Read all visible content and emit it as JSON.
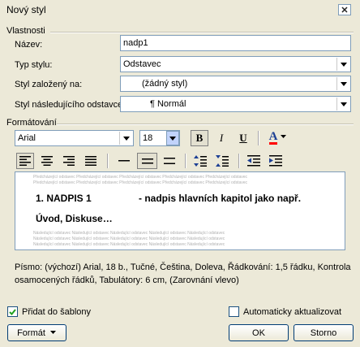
{
  "window": {
    "title": "Nový styl",
    "close_glyph": "✕"
  },
  "properties": {
    "section_label": "Vlastnosti",
    "name_label": "Název:",
    "name_value": "nadp1",
    "type_label": "Typ stylu:",
    "type_value": "Odstavec",
    "based_on_label": "Styl založený na:",
    "based_on_value": "(žádný styl)",
    "next_label": "Styl následujícího odstavce:",
    "next_value": "¶ Normál"
  },
  "formatting": {
    "section_label": "Formátování",
    "font_value": "Arial",
    "size_value": "18",
    "bold": "B",
    "italic": "I",
    "underline": "U",
    "font_color": "A"
  },
  "preview": {
    "dummy_text": "Předcházející odstavec Předcházející odstavec Předcházející odstavec Předcházející odstavec Předcházející odstavec",
    "following_text": "Následující odstavec Následující odstavec Následující odstavec Následující odstavec Následující odstavec",
    "line1_number": "1. NADPIS 1",
    "line1_rest": "- nadpis hlavních kapitol jako např.",
    "line2": "Úvod, Diskuse…"
  },
  "description": "Písmo: (výchozí) Arial, 18 b., Tučné, Čeština, Doleva, Řádkování:  1,5 řádku, Kontrola osamocených řádků, Tabulátory:  6 cm, (Zarovnání vlevo)",
  "options": {
    "add_to_template_label": "Přidat do šablony",
    "add_to_template_checked": true,
    "auto_update_label": "Automaticky aktualizovat",
    "auto_update_checked": false
  },
  "buttons": {
    "format": "Formát",
    "ok": "OK",
    "cancel": "Storno"
  },
  "colors": {
    "font_color_underline": "#ff0000",
    "accent_blue": "#1c5180"
  }
}
